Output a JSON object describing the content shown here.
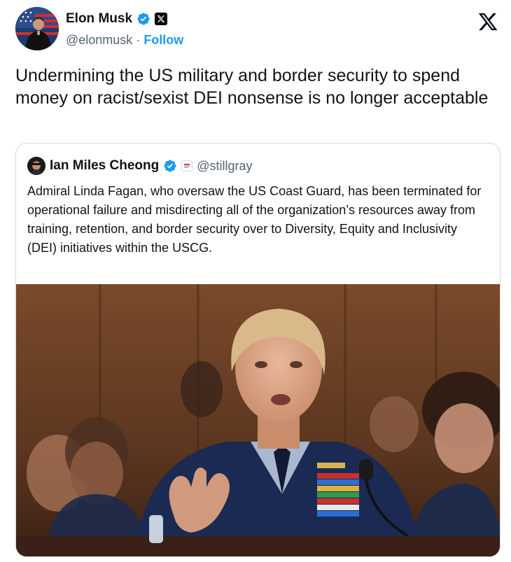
{
  "tweet": {
    "author": {
      "display_name": "Elon Musk",
      "handle": "@elonmusk",
      "separator": " · ",
      "follow_label": "Follow",
      "verified_icon": "verified-badge-icon",
      "affiliation_icon": "x-badge-icon"
    },
    "platform_logo": "x-logo-icon",
    "text": "Undermining the US military and border security to spend money on racist/sexist DEI nonsense is no longer acceptable"
  },
  "quoted_tweet": {
    "author": {
      "display_name": "Ian Miles Cheong",
      "handle": "@stillgray",
      "verified_icon": "verified-badge-icon",
      "affiliation_icon": "affiliate-badge-icon"
    },
    "text": "Admiral Linda Fagan, who oversaw the US Coast Guard, has been terminated for operational failure and misdirecting all of the organization’s resources away from training, retention, and border security over to Diversity, Equity and Inclusivity (DEI) initiatives within the USCG.",
    "media": {
      "kind": "photo"
    }
  },
  "colors": {
    "text_primary": "#0f1419",
    "text_secondary": "#536471",
    "accent": "#1d9bf0",
    "border": "#cfd9de"
  }
}
